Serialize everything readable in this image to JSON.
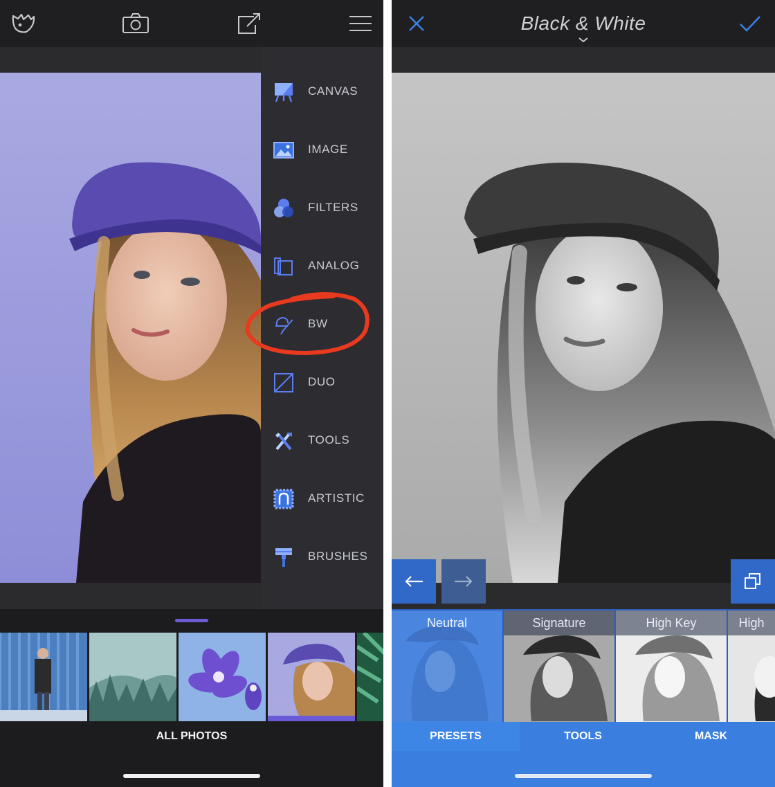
{
  "left": {
    "topbar": {
      "icons": [
        "bird-logo-icon",
        "camera-icon",
        "share-icon",
        "hamburger-menu-icon"
      ]
    },
    "menu": {
      "items": [
        {
          "label": "CANVAS",
          "icon": "canvas-icon"
        },
        {
          "label": "IMAGE",
          "icon": "image-icon"
        },
        {
          "label": "FILTERS",
          "icon": "filters-icon"
        },
        {
          "label": "ANALOG",
          "icon": "analog-icon"
        },
        {
          "label": "BW",
          "icon": "bw-icon",
          "highlighted": true
        },
        {
          "label": "DUO",
          "icon": "duo-icon"
        },
        {
          "label": "TOOLS",
          "icon": "tools-icon"
        },
        {
          "label": "ARTISTIC",
          "icon": "artistic-icon"
        },
        {
          "label": "BRUSHES",
          "icon": "brushes-icon"
        }
      ]
    },
    "gallery": {
      "label": "ALL PHOTOS",
      "thumbnails": [
        "man-in-coat-thumbnail",
        "misty-forest-thumbnail",
        "purple-flowers-thumbnail",
        "woman-in-hat-thumbnail",
        "green-leaves-thumbnail"
      ],
      "selected_index": 3
    },
    "colors": {
      "accent": "#6a5ad8",
      "annotation": "#e83a1f",
      "menu_bg": "#2c2c31"
    }
  },
  "right": {
    "topbar": {
      "title": "Black & White",
      "icons": [
        "close-icon",
        "checkmark-icon"
      ]
    },
    "presets": [
      {
        "label": "Neutral",
        "active": true
      },
      {
        "label": "Signature",
        "active": false
      },
      {
        "label": "High Key",
        "active": false
      },
      {
        "label": "High",
        "active": false
      }
    ],
    "tabs": [
      {
        "label": "PRESETS",
        "active": true
      },
      {
        "label": "TOOLS",
        "active": false
      },
      {
        "label": "MASK",
        "active": false
      }
    ],
    "colors": {
      "accent": "#3a7fe0",
      "icon_blue": "#3b82e3"
    }
  }
}
